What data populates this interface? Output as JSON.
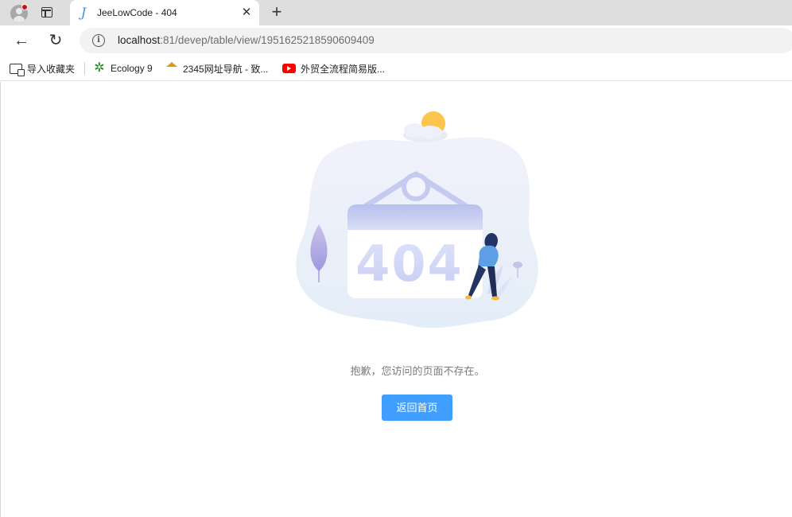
{
  "browser": {
    "tab": {
      "title": "JeeLowCode - 404",
      "close_glyph": "✕"
    },
    "new_tab_glyph": "+",
    "nav": {
      "back_glyph": "←",
      "reload_glyph": "↻"
    },
    "url": {
      "host": "localhost",
      "rest": ":81/devep/table/view/1951625218590609409"
    }
  },
  "bookmarks": [
    {
      "label": "导入收藏夹",
      "icon": "import-icon"
    },
    {
      "label": "Ecology 9",
      "icon": "ecology-icon"
    },
    {
      "label": "2345网址导航 - 致...",
      "icon": "2345-icon"
    },
    {
      "label": "外贸全流程简易版...",
      "icon": "youtube-icon"
    }
  ],
  "page": {
    "error_code": "404",
    "message": "抱歉，您访问的页面不存在。",
    "home_button": "返回首页"
  },
  "colors": {
    "primary_button": "#409eff",
    "sun": "#fbc54e",
    "blob": "#eef0fa"
  }
}
